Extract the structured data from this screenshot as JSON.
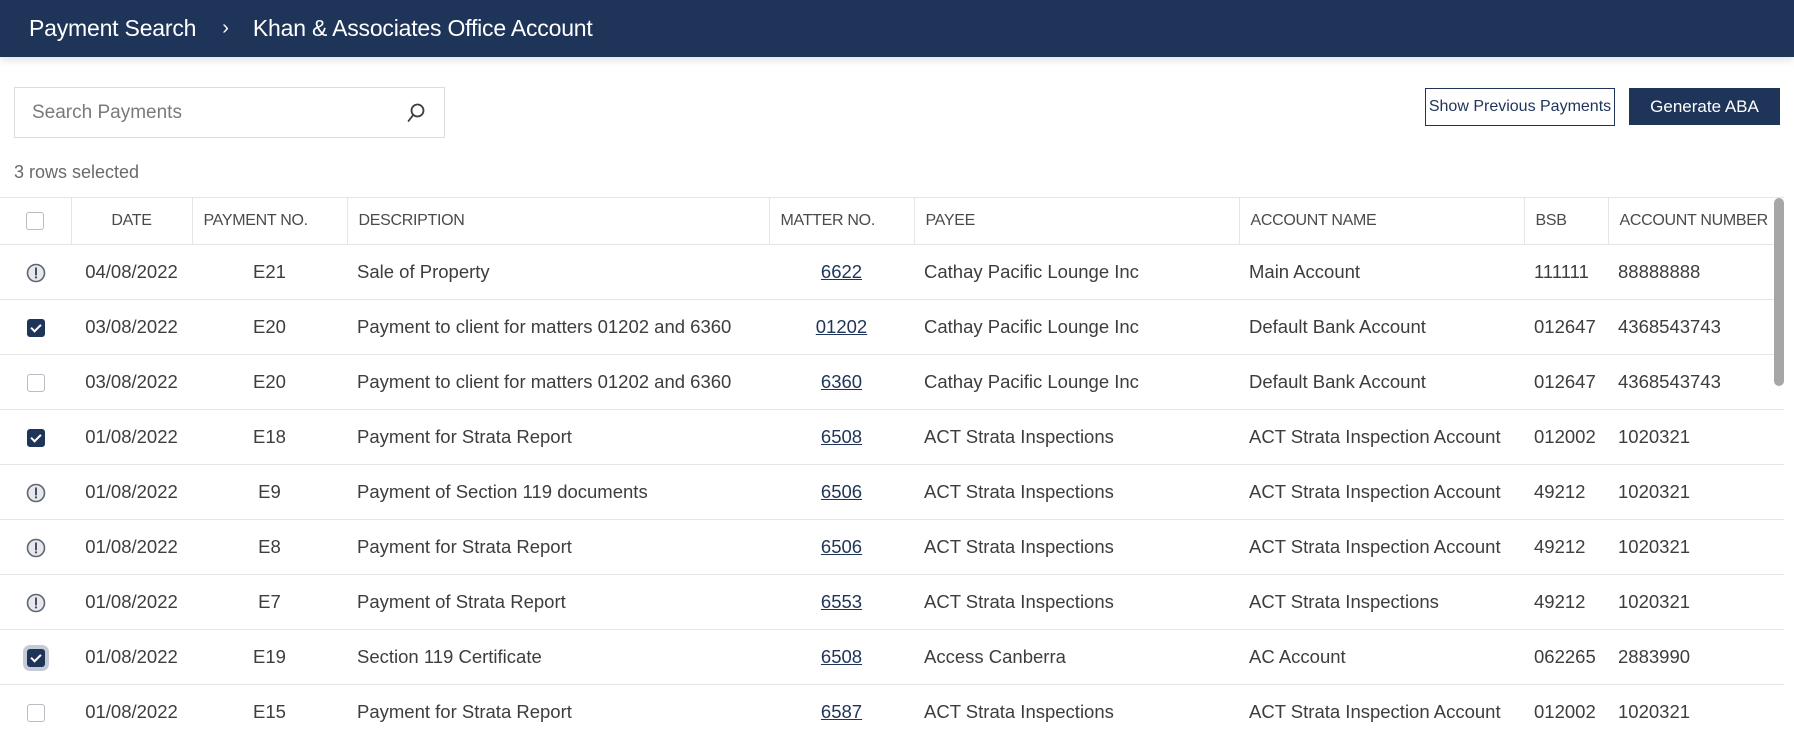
{
  "header": {
    "breadcrumb": [
      "Payment Search",
      "Khan & Associates Office Account"
    ],
    "separator": "›"
  },
  "search": {
    "placeholder": "Search Payments",
    "value": "",
    "icon": "search-icon"
  },
  "toolbar": {
    "show_previous_label": "Show Previous Payments",
    "generate_aba_label": "Generate ABA"
  },
  "selection": {
    "summary": "3 rows selected"
  },
  "colors": {
    "brand": "#1e3459",
    "border": "#e3e6ea"
  },
  "table": {
    "columns": [
      "DATE",
      "PAYMENT NO.",
      "DESCRIPTION",
      "MATTER NO.",
      "PAYEE",
      "ACCOUNT NAME",
      "BSB",
      "ACCOUNT NUMBER"
    ],
    "rows": [
      {
        "state": "warning",
        "date": "04/08/2022",
        "payment_no": "E21",
        "description": "Sale of Property",
        "matter_no": "6622",
        "payee": "Cathay Pacific Lounge Inc",
        "account_name": "Main Account",
        "bsb": "111111",
        "account_number": "88888888"
      },
      {
        "state": "checked",
        "date": "03/08/2022",
        "payment_no": "E20",
        "description": "Payment to client for matters 01202 and 6360",
        "matter_no": "01202",
        "payee": "Cathay Pacific Lounge Inc",
        "account_name": "Default Bank Account",
        "bsb": "012647",
        "account_number": "4368543743"
      },
      {
        "state": "unchecked",
        "date": "03/08/2022",
        "payment_no": "E20",
        "description": "Payment to client for matters 01202 and 6360",
        "matter_no": "6360",
        "payee": "Cathay Pacific Lounge Inc",
        "account_name": "Default Bank Account",
        "bsb": "012647",
        "account_number": "4368543743"
      },
      {
        "state": "checked",
        "date": "01/08/2022",
        "payment_no": "E18",
        "description": "Payment for Strata Report",
        "matter_no": "6508",
        "payee": "ACT Strata Inspections",
        "account_name": "ACT Strata Inspection Account",
        "bsb": "012002",
        "account_number": "1020321"
      },
      {
        "state": "warning",
        "date": "01/08/2022",
        "payment_no": "E9",
        "description": "Payment of Section 119 documents",
        "matter_no": "6506",
        "payee": "ACT Strata Inspections",
        "account_name": "ACT Strata Inspection Account",
        "bsb": "49212",
        "account_number": "1020321"
      },
      {
        "state": "warning",
        "date": "01/08/2022",
        "payment_no": "E8",
        "description": "Payment for Strata Report",
        "matter_no": "6506",
        "payee": "ACT Strata Inspections",
        "account_name": "ACT Strata Inspection Account",
        "bsb": "49212",
        "account_number": "1020321"
      },
      {
        "state": "warning",
        "date": "01/08/2022",
        "payment_no": "E7",
        "description": "Payment of Strata Report",
        "matter_no": "6553",
        "payee": "ACT Strata Inspections",
        "account_name": "ACT Strata Inspections",
        "bsb": "49212",
        "account_number": "1020321"
      },
      {
        "state": "checked-focus",
        "date": "01/08/2022",
        "payment_no": "E19",
        "description": "Section 119 Certificate",
        "matter_no": "6508",
        "payee": "Access Canberra",
        "account_name": "AC Account",
        "bsb": "062265",
        "account_number": "2883990"
      },
      {
        "state": "unchecked",
        "date": "01/08/2022",
        "payment_no": "E15",
        "description": "Payment for Strata Report",
        "matter_no": "6587",
        "payee": "ACT Strata Inspections",
        "account_name": "ACT Strata Inspection Account",
        "bsb": "012002",
        "account_number": "1020321"
      }
    ]
  }
}
